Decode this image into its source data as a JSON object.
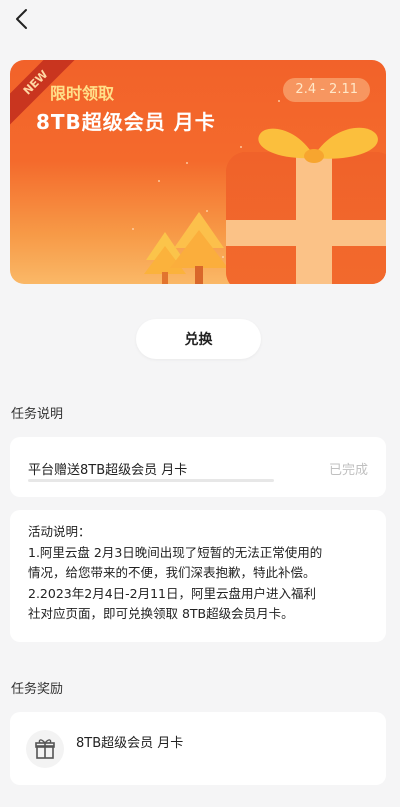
{
  "header": {
    "back_icon": "chevron-left-icon"
  },
  "banner": {
    "badge": "NEW",
    "tag": "限时领取",
    "title": "8TB超级会员 月卡",
    "date_range": "2.4 - 2.11",
    "colors": {
      "start": "#f2622a",
      "end": "#fab867",
      "gift": "#ef5a24",
      "bow": "#fbbf3d"
    }
  },
  "exchange_button": {
    "label": "兑换"
  },
  "task_section": {
    "title": "任务说明",
    "task": {
      "label": "平台赠送8TB超级会员 月卡",
      "status": "已完成",
      "progress": 0
    }
  },
  "description": {
    "lines": [
      "活动说明：",
      "1.阿里云盘 2月3日晚间出现了短暂的无法正常使用的",
      "情况，给您带来的不便，我们深表抱歉，特此补偿。",
      " 2.2023年2月4日-2月11日，阿里云盘用户进入福利",
      "社对应页面，即可兑换领取 8TB超级会员月卡。"
    ]
  },
  "reward_section": {
    "title": "任务奖励",
    "reward": {
      "icon": "gift-icon",
      "label": "8TB超级会员 月卡"
    }
  }
}
